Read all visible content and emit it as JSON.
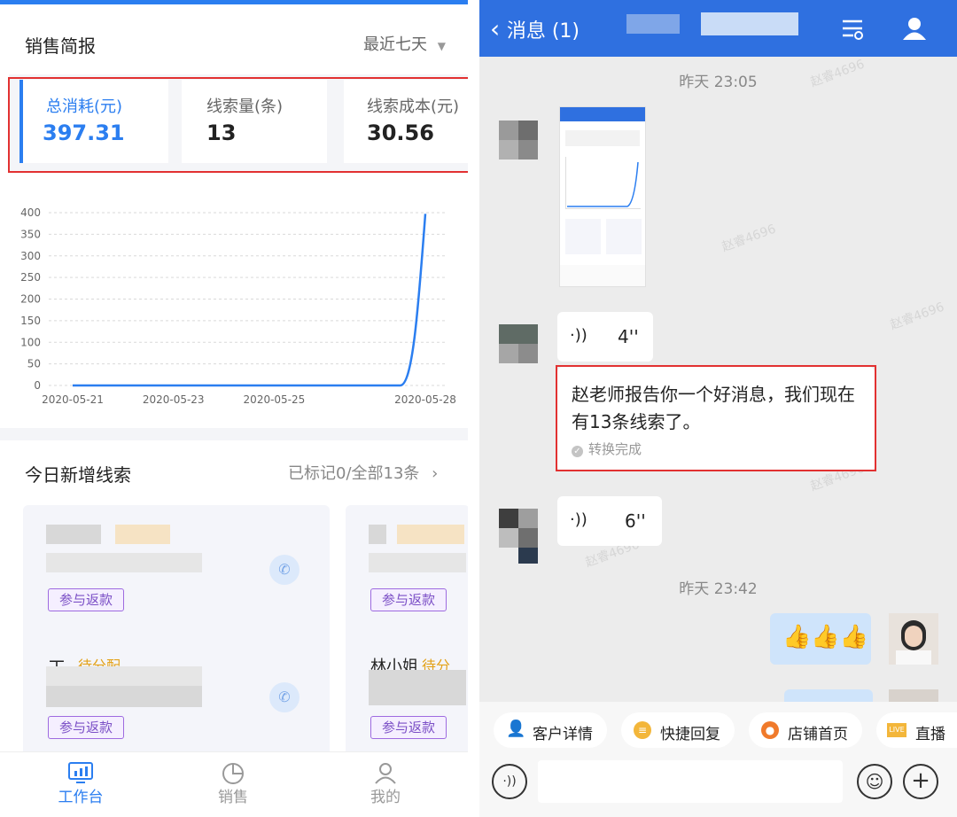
{
  "left": {
    "section_title": "销售简报",
    "range_label": "最近七天",
    "metrics": [
      {
        "label": "总消耗(元)",
        "value": "397.31"
      },
      {
        "label": "线索量(条)",
        "value": "13"
      },
      {
        "label": "线索成本(元)",
        "value": "30.56"
      }
    ],
    "chart_data": {
      "type": "line",
      "x": [
        "2020-05-21",
        "2020-05-22",
        "2020-05-23",
        "2020-05-24",
        "2020-05-25",
        "2020-05-26",
        "2020-05-27",
        "2020-05-28"
      ],
      "xticks": [
        "2020-05-21",
        "2020-05-23",
        "2020-05-25",
        "2020-05-28"
      ],
      "series": [
        {
          "values": [
            0,
            0,
            0,
            0,
            0,
            0,
            0,
            397.31
          ]
        }
      ],
      "yticks": [
        "400",
        "350",
        "300",
        "250",
        "200",
        "150",
        "100",
        "50",
        "0"
      ],
      "ylim": [
        0,
        400
      ],
      "grid": true,
      "color": "#2b7ef0"
    },
    "leads": {
      "title": "今日新增线索",
      "summary": "已标记0/全部13条",
      "tag_label": "参与返款",
      "partial_names": [
        "王",
        "林小姐"
      ],
      "partial_status": [
        "待分配",
        "待分"
      ]
    },
    "nav": [
      {
        "label": "工作台",
        "icon": "chart-board-icon",
        "active": true
      },
      {
        "label": "销售",
        "icon": "pie-chart-icon",
        "active": false
      },
      {
        "label": "我的",
        "icon": "user-icon",
        "active": false
      }
    ]
  },
  "right": {
    "header": {
      "back_label": "消息 (1)"
    },
    "times": [
      "昨天 23:05",
      "昨天 23:42"
    ],
    "watermark": "赵睿4696",
    "voice1": "4''",
    "voice2": "6''",
    "transcript": "赵老师报告你一个好消息，我们现在有13条线索了。",
    "transcript_status": "转换完成",
    "quick_actions": [
      "客户详情",
      "快捷回复",
      "店铺首页",
      "直播"
    ]
  }
}
